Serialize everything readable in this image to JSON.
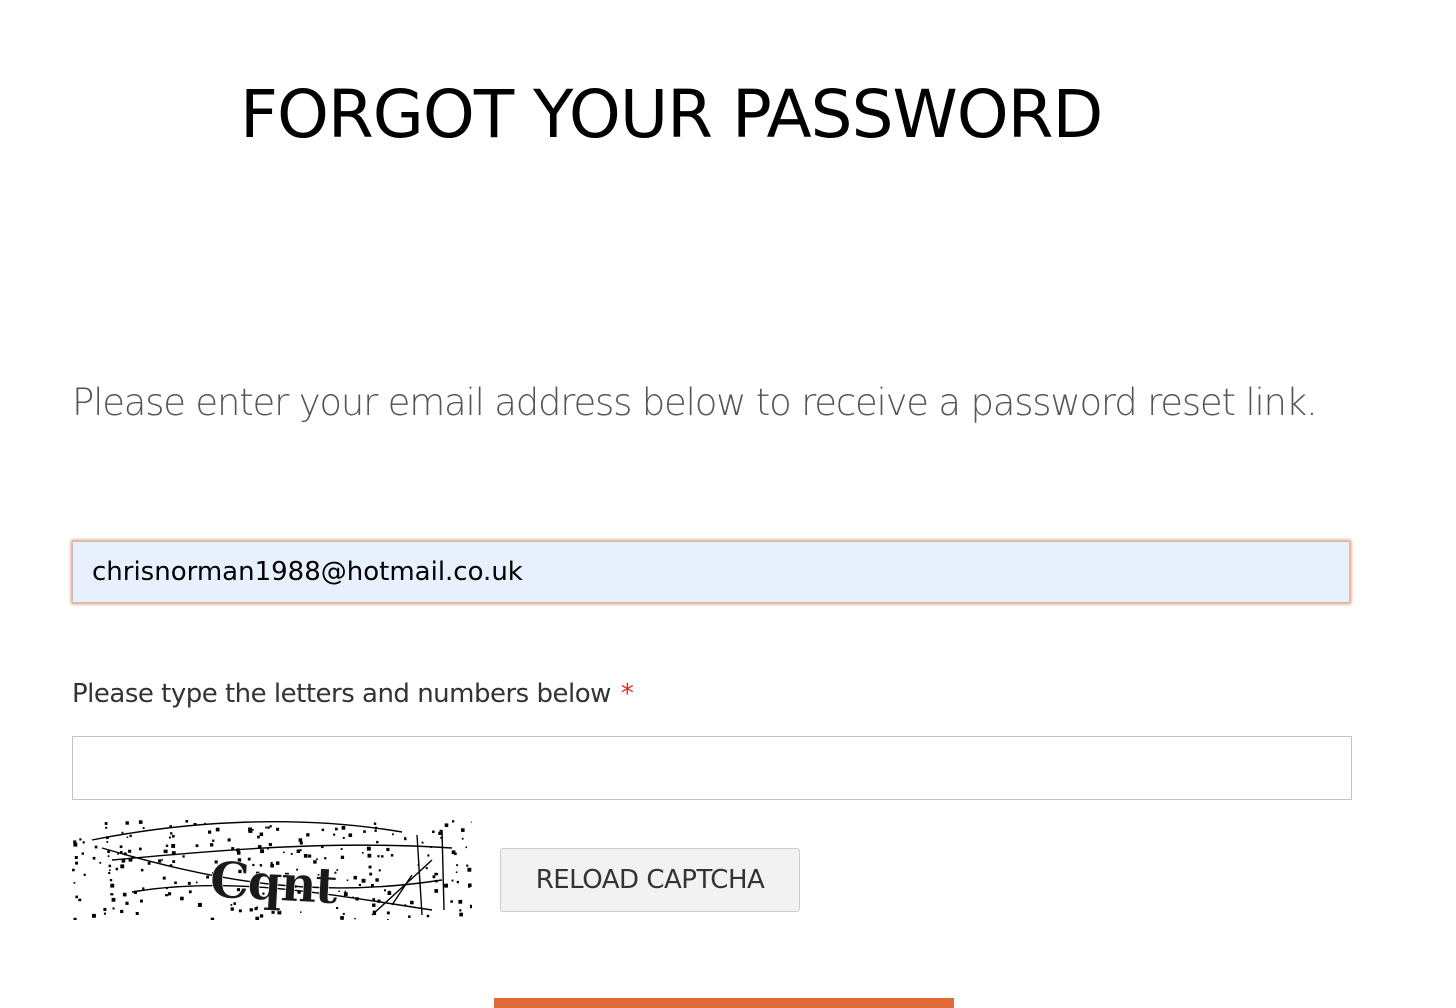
{
  "page": {
    "title": "FORGOT YOUR PASSWORD",
    "intro": "Please enter your email address below to receive a password reset link."
  },
  "form": {
    "email": {
      "value": "chrisnorman1988@hotmail.co.uk"
    },
    "captcha": {
      "label": "Please type the letters and numbers below",
      "required_marker": "*",
      "value": "",
      "image_text": "Cqnt",
      "reload_label": "RELOAD CAPTCHA"
    },
    "submit": {
      "label": ""
    }
  },
  "colors": {
    "accent": "#e06a38",
    "required": "#e02b27",
    "autofill_background": "#e8f0fe",
    "focus_glow": "#f08a5d"
  }
}
